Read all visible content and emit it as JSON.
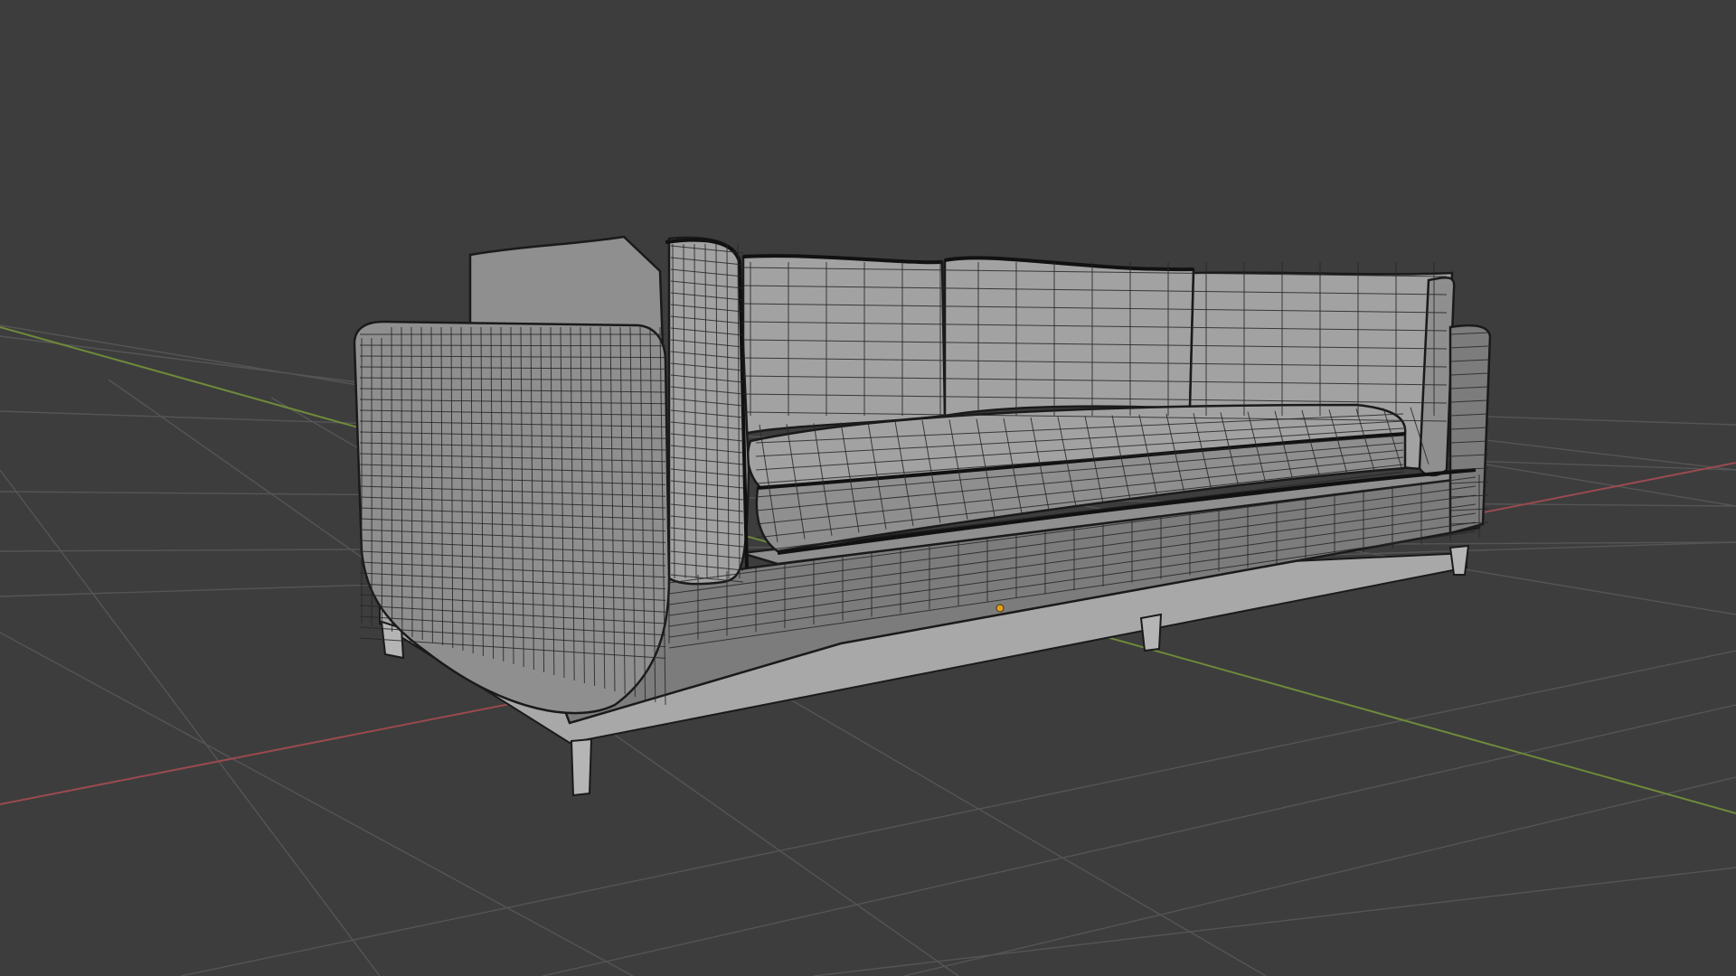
{
  "viewport": {
    "background_color": "#3d3d3d",
    "grid_color": "#555555",
    "x_axis_color": "#9a4a4f",
    "y_axis_color": "#6f8a3b",
    "display_mode": "wireframe-overlay",
    "object": "sofa"
  },
  "mesh": {
    "face_color": "#8f8f8f",
    "wire_color": "#262626",
    "origin_color": "#e0a020"
  }
}
